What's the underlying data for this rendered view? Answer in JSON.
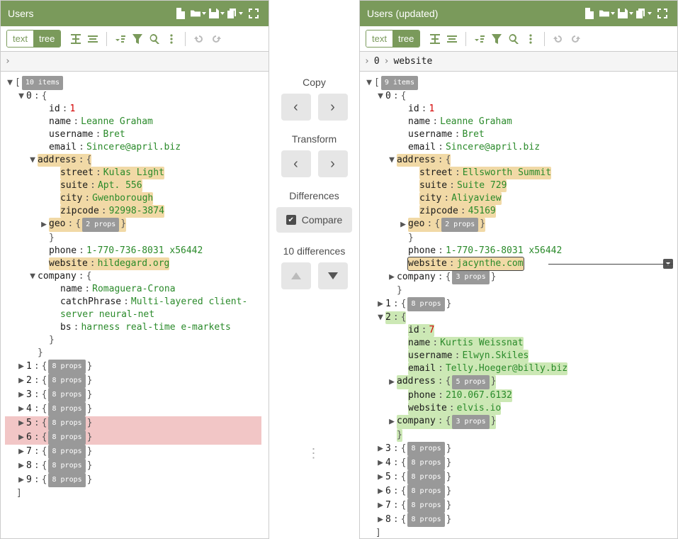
{
  "left": {
    "title": "Users",
    "mode_text_label": "text",
    "mode_tree_label": "tree",
    "root_badge": "10 items",
    "user0": {
      "idx": "0",
      "id": "1",
      "name": "Leanne Graham",
      "username": "Bret",
      "email": "Sincere@april.biz",
      "addr_k": "address",
      "street": "Kulas Light",
      "suite": "Apt. 556",
      "city": "Gwenborough",
      "zipcode": "92998-3874",
      "geo_k": "geo",
      "geo_badge": "2 props",
      "phone": "1-770-736-8031 x56442",
      "website": "hildegard.org",
      "company_k": "company",
      "company_name": "Romaguera-Crona",
      "catch_k": "catchPhrase",
      "catch": "Multi-layered client-server neural-net",
      "bs_k": "bs",
      "bs": "harness real-time e-markets",
      "street_k": "street",
      "suite_k": "suite",
      "city_k": "city",
      "zipcode_k": "zipcode",
      "phone_k": "phone",
      "website_k": "website",
      "name_k": "name",
      "username_k": "username",
      "email_k": "email",
      "id_k": "id",
      "cname_k": "name"
    },
    "collapsed": {
      "badge": "8 props"
    },
    "idx1": "1",
    "idx2": "2",
    "idx3": "3",
    "idx4": "4",
    "idx5": "5",
    "idx6": "6",
    "idx7": "7",
    "idx8": "8",
    "idx9": "9"
  },
  "right": {
    "title": "Users (updated)",
    "mode_text_label": "text",
    "mode_tree_label": "tree",
    "crumb0": "0",
    "crumb1": "website",
    "root_badge": "9 items",
    "user0": {
      "idx": "0",
      "id": "1",
      "name": "Leanne Graham",
      "username": "Bret",
      "email": "Sincere@april.biz",
      "addr_k": "address",
      "street": "Ellsworth Summit",
      "suite": "Suite 729",
      "city": "Aliyaview",
      "zipcode": "45169",
      "geo_k": "geo",
      "geo_badge": "2 props",
      "phone": "1-770-736-8031 x56442",
      "website": "jacynthe.com",
      "company_k": "company",
      "company_badge": "3 props",
      "street_k": "street",
      "suite_k": "suite",
      "city_k": "city",
      "zipcode_k": "zipcode",
      "phone_k": "phone",
      "website_k": "website",
      "name_k": "name",
      "username_k": "username",
      "email_k": "email",
      "id_k": "id"
    },
    "idx1": "1",
    "idx1_badge": "8 props",
    "user2": {
      "idx": "2",
      "id": "7",
      "name": "Kurtis Weissnat",
      "username": "Elwyn.Skiles",
      "email": "Telly.Hoeger@billy.biz",
      "addr_k": "address",
      "addr_badge": "5 props",
      "phone": "210.067.6132",
      "website": "elvis.io",
      "company_k": "company",
      "company_badge": "3 props",
      "id_k": "id",
      "name_k": "name",
      "username_k": "username",
      "email_k": "email",
      "phone_k": "phone",
      "website_k": "website"
    },
    "idx3": "3",
    "idx4": "4",
    "idx5": "5",
    "idx6": "6",
    "idx7": "7",
    "idx8": "8",
    "collapsed_badge": "8 props"
  },
  "mid": {
    "copy_label": "Copy",
    "transform_label": "Transform",
    "diff_label": "Differences",
    "compare_label": "Compare",
    "diff_count": "10 differences"
  }
}
